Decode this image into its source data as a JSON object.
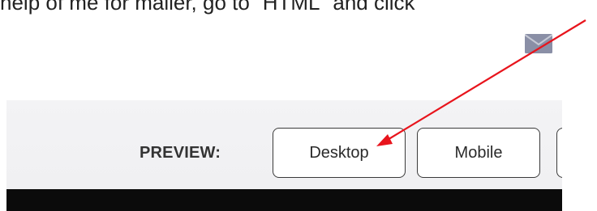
{
  "doc": {
    "text_line": "help of me for mailer, go to “HTML” and click"
  },
  "icons": {
    "mail": "mail-envelope-icon"
  },
  "preview": {
    "label": "PREVIEW:",
    "buttons": [
      {
        "label": "Desktop"
      },
      {
        "label": "Mobile"
      },
      {
        "label": ""
      }
    ]
  },
  "annotation": {
    "arrow_color": "#e8141c"
  }
}
